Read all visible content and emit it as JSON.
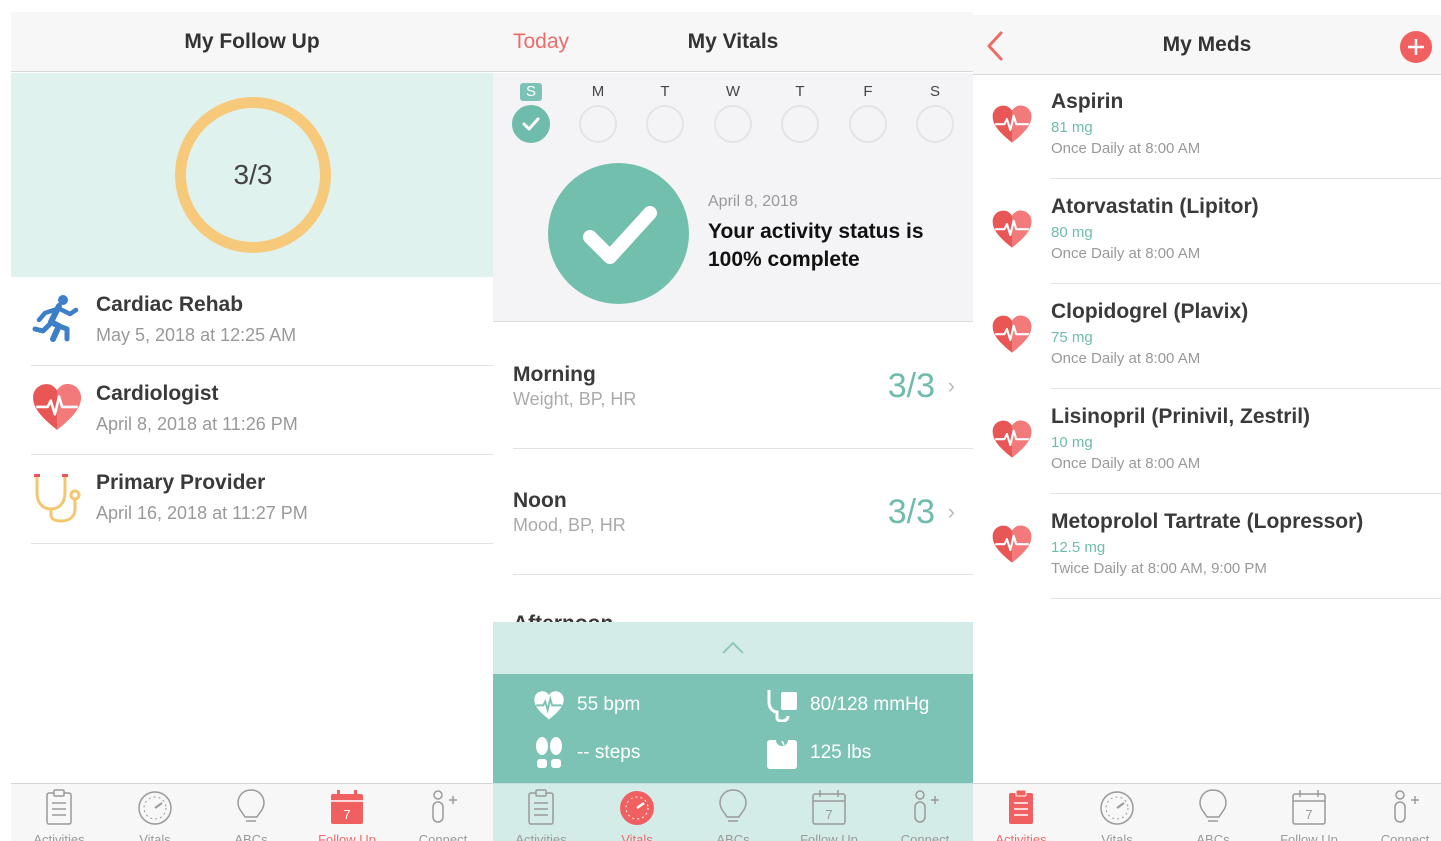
{
  "follow_up": {
    "title": "My Follow Up",
    "progress_label": "3/3",
    "items": [
      {
        "title": "Cardiac Rehab",
        "subtitle": "May 5, 2018 at 12:25 AM",
        "icon": "runner-icon"
      },
      {
        "title": "Cardiologist",
        "subtitle": "April 8, 2018 at 11:26 PM",
        "icon": "heart-icon"
      },
      {
        "title": "Primary Provider",
        "subtitle": "April 16, 2018 at 11:27 PM",
        "icon": "stethoscope-icon"
      }
    ]
  },
  "vitals": {
    "title": "My Vitals",
    "today_label": "Today",
    "days": [
      "S",
      "M",
      "T",
      "W",
      "T",
      "F",
      "S"
    ],
    "status_date": "April 8, 2018",
    "status_text": "Your activity status is 100% complete",
    "rows": [
      {
        "title": "Morning",
        "subtitle": "Weight, BP, HR",
        "count": "3/3"
      },
      {
        "title": "Noon",
        "subtitle": "Mood, BP, HR",
        "count": "3/3"
      }
    ],
    "partial_row": "Afternoon",
    "metrics": {
      "heart_rate": "55 bpm",
      "blood_pressure": "80/128 mmHg",
      "steps": "-- steps",
      "weight": "125 lbs"
    }
  },
  "meds": {
    "title": "My Meds",
    "items": [
      {
        "name": "Aspirin",
        "dose": "81 mg",
        "schedule": "Once Daily at 8:00 AM"
      },
      {
        "name": "Atorvastatin (Lipitor)",
        "dose": "80 mg",
        "schedule": "Once Daily at 8:00 AM"
      },
      {
        "name": "Clopidogrel (Plavix)",
        "dose": "75 mg",
        "schedule": "Once Daily at 8:00 AM"
      },
      {
        "name": "Lisinopril (Prinivil, Zestril)",
        "dose": "10 mg",
        "schedule": "Once Daily at 8:00 AM"
      },
      {
        "name": "Metoprolol Tartrate (Lopressor)",
        "dose": "12.5 mg",
        "schedule": "Twice Daily at 8:00 AM, 9:00 PM"
      }
    ]
  },
  "tabs": {
    "labels": [
      "Activities",
      "Vitals",
      "ABCs",
      "Follow Up",
      "Connect"
    ],
    "calendar_day": "7",
    "active_panel1": "Follow Up",
    "active_panel2": "Vitals",
    "active_panel3": "Activities"
  },
  "colors": {
    "accent_red": "#f06a6a",
    "teal": "#6fbcac",
    "ring_yellow": "#f7c97a",
    "hero_mint": "#e0f2ee"
  }
}
